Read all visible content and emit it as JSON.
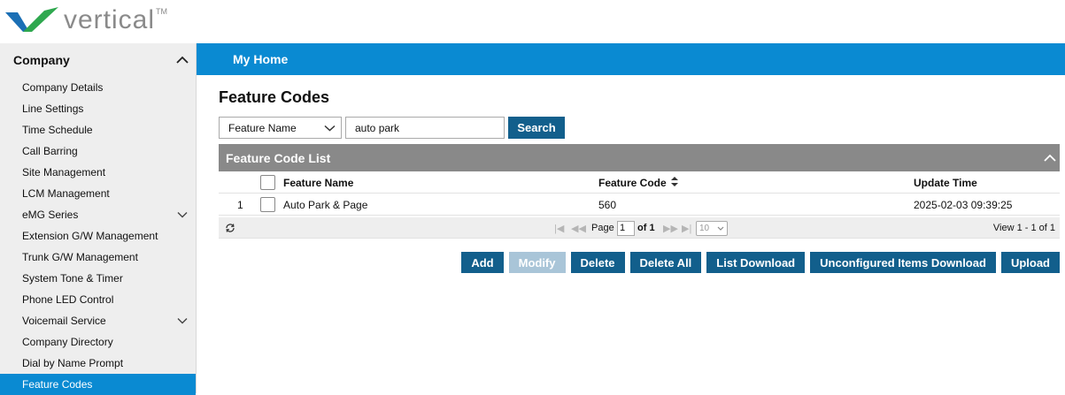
{
  "brand": {
    "logo_text": "vertical",
    "tm": "TM"
  },
  "sidebar": {
    "section": "Company",
    "items": [
      {
        "label": "Company Details"
      },
      {
        "label": "Line Settings"
      },
      {
        "label": "Time Schedule"
      },
      {
        "label": "Call Barring"
      },
      {
        "label": "Site Management"
      },
      {
        "label": "LCM Management"
      },
      {
        "label": "eMG Series",
        "expandable": true
      },
      {
        "label": "Extension G/W Management"
      },
      {
        "label": "Trunk G/W Management"
      },
      {
        "label": "System Tone & Timer"
      },
      {
        "label": "Phone LED Control"
      },
      {
        "label": "Voicemail Service",
        "expandable": true
      },
      {
        "label": "Company Directory"
      },
      {
        "label": "Dial by Name Prompt"
      },
      {
        "label": "Feature Codes",
        "active": true
      }
    ]
  },
  "navbar": {
    "home": "My Home"
  },
  "page": {
    "title": "Feature Codes"
  },
  "search": {
    "field_selected": "Feature Name",
    "value": "auto park",
    "button": "Search"
  },
  "panel": {
    "title": "Feature Code List"
  },
  "table": {
    "columns": [
      "Feature Name",
      "Feature Code",
      "Update Time"
    ],
    "rows": [
      {
        "index": "1",
        "name": "Auto Park & Page",
        "code": "560",
        "updated": "2025-02-03 09:39:25"
      }
    ]
  },
  "pager": {
    "page_label": "Page",
    "page_value": "1",
    "of_label": "of 1",
    "rows_per_page": "10",
    "view_text": "View 1 - 1 of 1"
  },
  "actions": {
    "add": "Add",
    "modify": "Modify",
    "delete": "Delete",
    "delete_all": "Delete All",
    "list_download": "List Download",
    "unconfigured_download": "Unconfigured Items Download",
    "upload": "Upload"
  },
  "colors": {
    "accent": "#0a8ad2",
    "button": "#125f8c",
    "button_disabled": "#a9c5d8",
    "panel_header": "#898989",
    "sidebar_bg": "#eeeeee"
  }
}
